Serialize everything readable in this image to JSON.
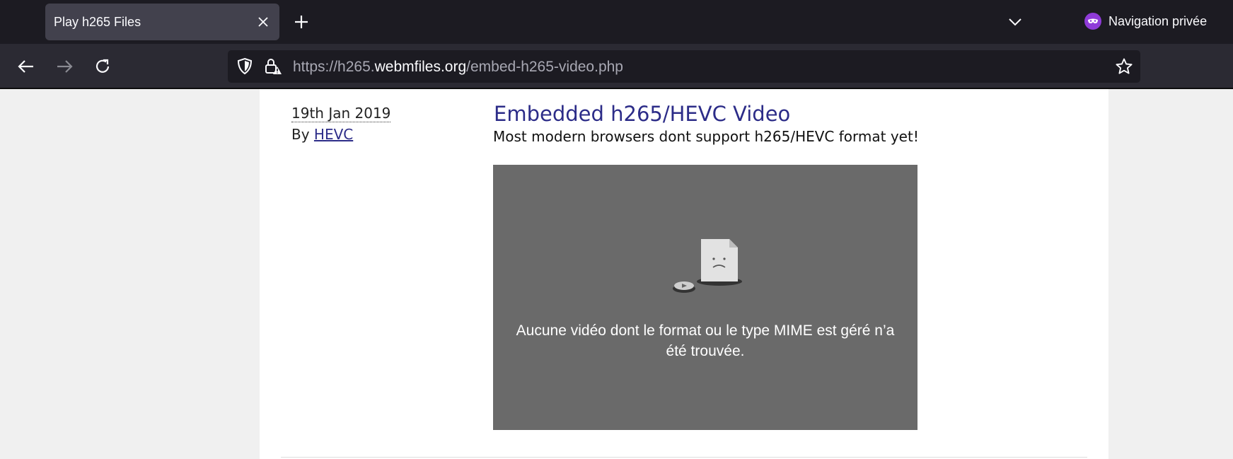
{
  "browser": {
    "tab_title": "Play h265 Files",
    "private_label": "Navigation privée",
    "url_prefix": "https://h265.",
    "url_host": "webmfiles.org",
    "url_path": "/embed-h265-video.php"
  },
  "article": {
    "date": "19th Jan 2019",
    "by_label": "By",
    "author": "HEVC",
    "title": "Embedded h265/HEVC Video",
    "subtitle": "Most modern browsers dont support h265/HEVC format yet!",
    "video_error": "Aucune vidéo dont le format ou le type MIME est géré n’a été trouvée."
  },
  "colors": {
    "tab_strip": "#1c1b22",
    "nav_bar": "#2b2a33",
    "private_accent": "#8f3bd8",
    "link": "#2c2c88",
    "video_bg": "#6a6a6a"
  },
  "icons": [
    "close-icon",
    "plus-icon",
    "chevron-down-icon",
    "private-mask-icon",
    "back-arrow-icon",
    "forward-arrow-icon",
    "reload-icon",
    "shield-icon",
    "lock-warning-icon",
    "star-icon",
    "broken-video-icon"
  ]
}
